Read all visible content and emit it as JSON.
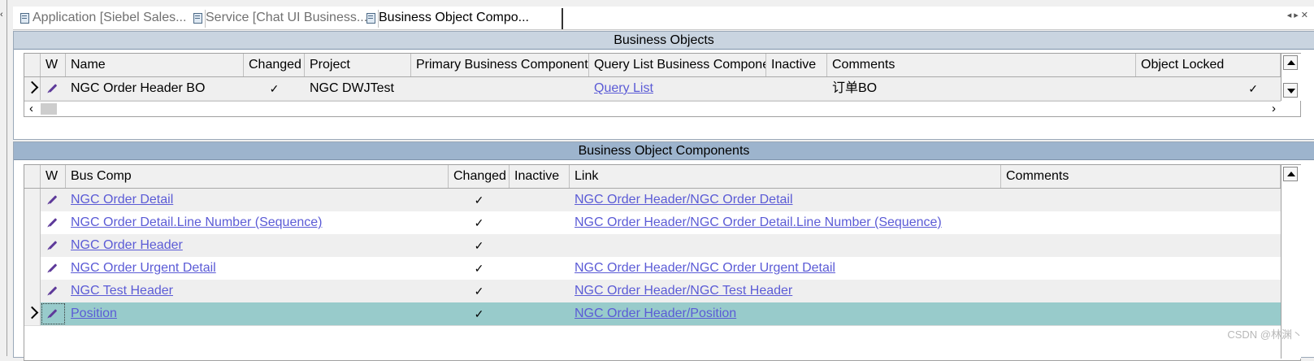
{
  "tabs": [
    {
      "label": "Application [Siebel Sales..."
    },
    {
      "label": "Service [Chat UI Business..."
    },
    {
      "label": "Business Object Compo..."
    }
  ],
  "bo_panel": {
    "title": "Business Objects",
    "columns": [
      "W",
      "Name",
      "Changed",
      "Project",
      "Primary Business Component",
      "Query List Business Compone",
      "Inactive",
      "Comments",
      "Object Locked"
    ],
    "row": {
      "name": "NGC Order Header BO",
      "changed": "✓",
      "project": "NGC DWJTest",
      "primary_bc": "",
      "query_list": "Query List",
      "inactive": "",
      "comments": "订单BO",
      "object_locked": "✓"
    }
  },
  "boc_panel": {
    "title": "Business Object Components",
    "columns": [
      "W",
      "Bus Comp",
      "Changed",
      "Inactive",
      "Link",
      "Comments"
    ],
    "rows": [
      {
        "bus_comp": "NGC Order Detail",
        "changed": "✓",
        "inactive": "",
        "link": "NGC Order Header/NGC Order Detail",
        "comments": ""
      },
      {
        "bus_comp": "NGC Order Detail.Line Number (Sequence)",
        "changed": "✓",
        "inactive": "",
        "link": "NGC Order Header/NGC Order Detail.Line Number (Sequence)",
        "comments": ""
      },
      {
        "bus_comp": "NGC Order Header",
        "changed": "✓",
        "inactive": "",
        "link": "",
        "comments": ""
      },
      {
        "bus_comp": "NGC Order Urgent Detail",
        "changed": "✓",
        "inactive": "",
        "link": "NGC Order Header/NGC Order Urgent Detail",
        "comments": ""
      },
      {
        "bus_comp": "NGC Test Header",
        "changed": "✓",
        "inactive": "",
        "link": "NGC Order Header/NGC Test Header",
        "comments": ""
      },
      {
        "bus_comp": "Position",
        "changed": "✓",
        "inactive": "",
        "link": "NGC Order Header/Position",
        "comments": ""
      }
    ]
  },
  "watermark": "CSDN @林渊丶",
  "colors": {
    "selected_row": "#98cbcb",
    "link": "#5b5bd6",
    "header_bar": "#9db4cd"
  }
}
